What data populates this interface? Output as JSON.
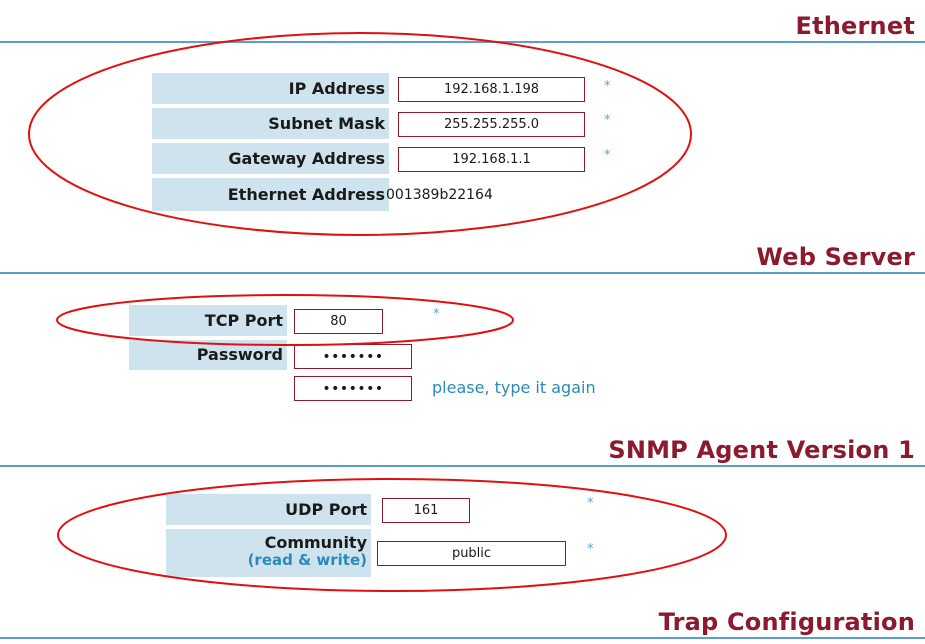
{
  "ethernet": {
    "title": "Ethernet",
    "ip_label": "IP Address",
    "ip_value": "192.168.1.198",
    "mask_label": "Subnet Mask",
    "mask_value": "255.255.255.0",
    "gateway_label": "Gateway Address",
    "gateway_value": "192.168.1.1",
    "mac_label": "Ethernet Address",
    "mac_value": "001389b22164",
    "required_mark": "*"
  },
  "web_server": {
    "title": "Web Server",
    "tcp_label": "TCP Port",
    "tcp_value": "80",
    "password_label": "Password",
    "password_value": "•••••••",
    "password_confirm_value": "•••••••",
    "password_hint": "please, type it again",
    "required_mark": "*"
  },
  "snmp": {
    "title": "SNMP Agent Version 1",
    "udp_label": "UDP Port",
    "udp_value": "161",
    "community_label": "Community",
    "community_sublabel": "(read & write)",
    "community_value": "public",
    "required_mark": "*"
  },
  "trap": {
    "title": "Trap Configuration"
  },
  "colors": {
    "heading": "#8b1a2e",
    "rule": "#5a9ec9",
    "label_bg": "#cfe3ee",
    "accent": "#2a8bb6",
    "annotation": "#e01010"
  }
}
